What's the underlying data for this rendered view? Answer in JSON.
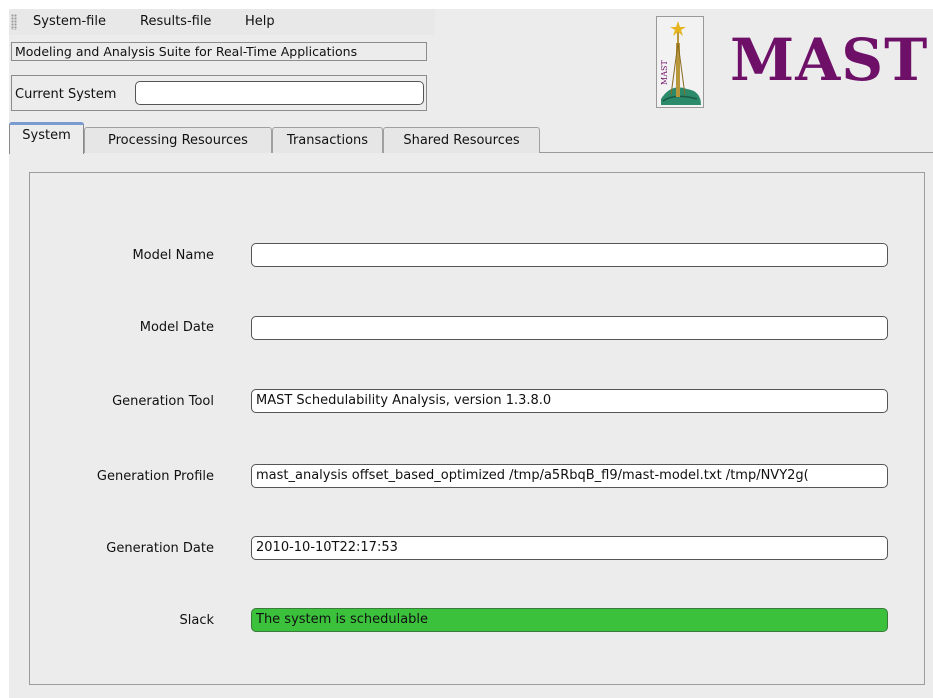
{
  "menu": {
    "items": [
      "System-file",
      "Results-file",
      "Help"
    ]
  },
  "suite_title": "Modeling and Analysis Suite for Real-Time Applications",
  "current_system": {
    "label": "Current System",
    "value": ""
  },
  "logo": {
    "text": "MAST",
    "image_text": "MAST",
    "color": "#6e1068"
  },
  "tabs": [
    {
      "label": "System",
      "active": true
    },
    {
      "label": "Processing Resources",
      "active": false
    },
    {
      "label": "Transactions",
      "active": false
    },
    {
      "label": "Shared Resources",
      "active": false
    }
  ],
  "fields": {
    "model_name": {
      "label": "Model Name",
      "value": ""
    },
    "model_date": {
      "label": "Model Date",
      "value": ""
    },
    "generation_tool": {
      "label": "Generation Tool",
      "value": "MAST Schedulability Analysis, version 1.3.8.0"
    },
    "generation_profile": {
      "label": "Generation Profile",
      "value": "mast_analysis offset_based_optimized /tmp/a5RbqB_fl9/mast-model.txt /tmp/NVY2g("
    },
    "generation_date": {
      "label": "Generation Date",
      "value": "2010-10-10T22:17:53"
    },
    "slack": {
      "label": "Slack",
      "value": "The system is schedulable",
      "color": "#3cc13c"
    }
  }
}
